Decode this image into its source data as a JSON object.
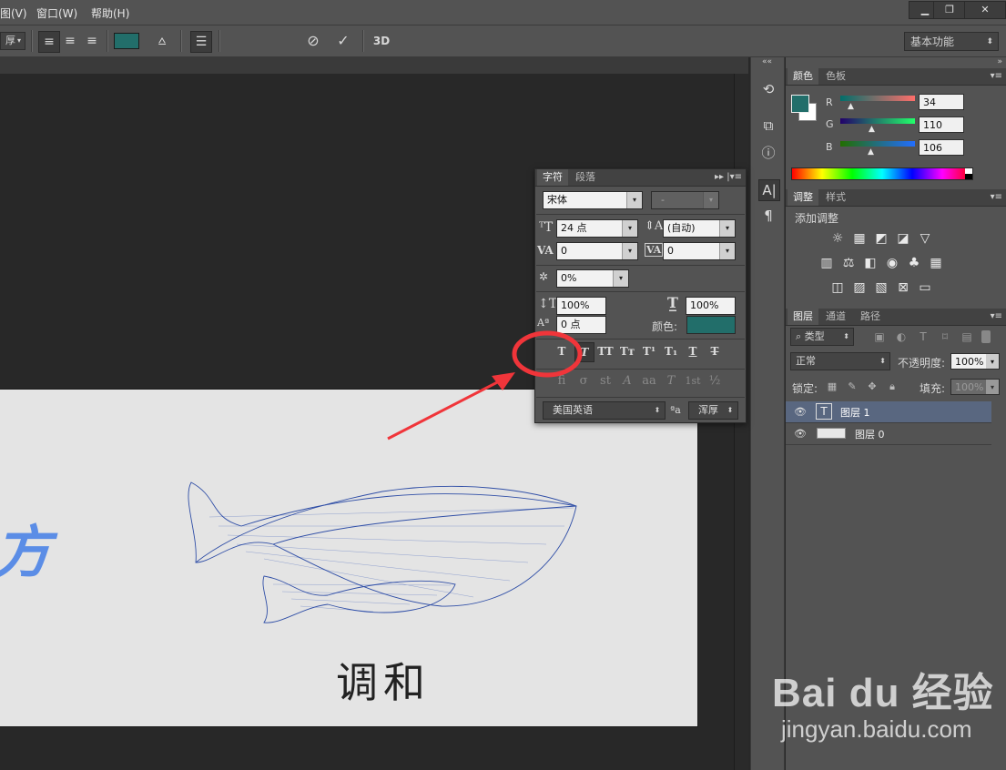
{
  "menu": {
    "items": [
      "图(V)",
      "窗口(W)",
      "帮助(H)"
    ],
    "window_controls": [
      "▁",
      "❐",
      "✕"
    ]
  },
  "options_bar": {
    "font_style_fragment": "厚",
    "workspace": "基本功能",
    "mode_label": "3D"
  },
  "color_panel": {
    "tabs": [
      "颜色",
      "色板"
    ],
    "r_label": "R",
    "r_value": "34",
    "g_label": "G",
    "g_value": "110",
    "b_label": "B",
    "b_value": "106",
    "foreground": "#226e6a"
  },
  "adjust_panel": {
    "tabs": [
      "调整",
      "样式"
    ],
    "title": "添加调整"
  },
  "layers_panel": {
    "tabs": [
      "图层",
      "通道",
      "路径"
    ],
    "filter": "类型",
    "blend_mode": "正常",
    "opacity_label": "不透明度:",
    "opacity_value": "100%",
    "lock_label": "锁定:",
    "fill_label": "填充:",
    "fill_value": "100%",
    "layers": [
      {
        "name": "图层 1",
        "thumb": "T"
      },
      {
        "name": "图层 0",
        "thumb": ""
      }
    ]
  },
  "character_panel": {
    "tabs": [
      "字符",
      "段落"
    ],
    "font_family": "宋体",
    "font_style": "-",
    "font_size": "24 点",
    "leading": "(自动)",
    "kerning": "0",
    "tracking": "0",
    "tsume": "0%",
    "vscale": "100%",
    "hscale": "100%",
    "baseline": "0 点",
    "color_label": "颜色:",
    "color": "#226e6a",
    "style_buttons": [
      "T",
      "T",
      "TT",
      "Tт",
      "T¹",
      "T₁",
      "T",
      "T"
    ],
    "opentype_buttons": [
      "ﬁ",
      "σ",
      "st",
      "A",
      "aa",
      "T",
      "1st",
      "½"
    ],
    "language": "美国英语",
    "aa_icon": "ªa",
    "antialias": "浑厚"
  },
  "canvas": {
    "text_main": "调和",
    "text_side": "方"
  },
  "watermark": {
    "line1": "Bai du 经验",
    "line2": "jingyan.baidu.com"
  }
}
